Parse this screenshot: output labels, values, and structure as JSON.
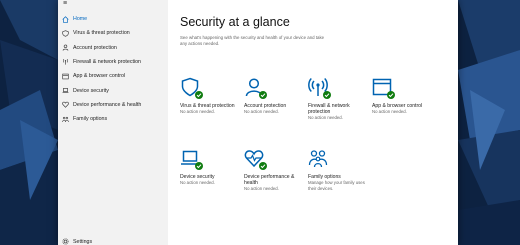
{
  "sidebar": {
    "menu_icon": "hamburger-icon",
    "items": [
      {
        "label": "Home",
        "icon": "home-icon",
        "active": true
      },
      {
        "label": "Virus & threat protection",
        "icon": "shield-icon"
      },
      {
        "label": "Account protection",
        "icon": "person-icon"
      },
      {
        "label": "Firewall & network protection",
        "icon": "antenna-icon"
      },
      {
        "label": "App & browser control",
        "icon": "browser-window-icon"
      },
      {
        "label": "Device security",
        "icon": "laptop-icon"
      },
      {
        "label": "Device performance & health",
        "icon": "heart-icon"
      },
      {
        "label": "Family options",
        "icon": "family-icon"
      }
    ],
    "settings_label": "Settings"
  },
  "main": {
    "title": "Security at a glance",
    "subtitle": "See what's happening with the security and health of your device and take any actions needed.",
    "tiles": [
      {
        "title": "Virus & threat protection",
        "status": "No action needed.",
        "icon": "shield-icon"
      },
      {
        "title": "Account protection",
        "status": "No action needed.",
        "icon": "person-icon"
      },
      {
        "title": "Firewall & network protection",
        "status": "No action needed.",
        "icon": "antenna-icon"
      },
      {
        "title": "App & browser control",
        "status": "No action needed.",
        "icon": "browser-window-icon"
      },
      {
        "title": "Device security",
        "status": "No action needed.",
        "icon": "laptop-icon"
      },
      {
        "title": "Device performance & health",
        "status": "No action needed.",
        "icon": "heart-pulse-icon"
      },
      {
        "title": "Family options",
        "status": "Manage how your family uses their devices.",
        "icon": "family-icon"
      }
    ]
  },
  "colors": {
    "accent": "#0067c0",
    "icon_blue": "#0063b1",
    "check_green": "#107c10",
    "sidebar_bg": "#f2f2f2"
  }
}
